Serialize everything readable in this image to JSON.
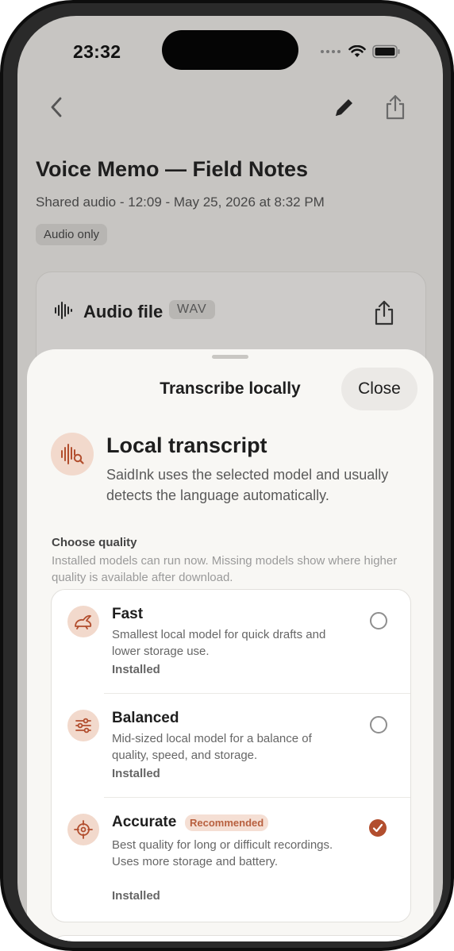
{
  "status_bar": {
    "time": "23:32",
    "icons": [
      "cellular-dots-icon",
      "wifi-icon",
      "battery-icon"
    ]
  },
  "nav": {
    "icons": [
      "chevron-left-icon",
      "pencil-icon",
      "share-icon"
    ]
  },
  "memo": {
    "title": "Voice Memo — Field Notes",
    "subtitle": "Shared audio - 12:09 - May 25, 2026 at 8:32 PM",
    "tag": "Audio only"
  },
  "audio_card": {
    "label": "Audio file",
    "format": "WAV",
    "icons": [
      "waveform-icon",
      "share-icon"
    ]
  },
  "sheet": {
    "title": "Transcribe locally",
    "close_label": "Close",
    "hero_title": "Local transcript",
    "hero_description": "SaidInk uses the selected model and usually detects the language automatically.",
    "quality_label": "Choose quality",
    "quality_hint": "Installed models can run now. Missing models show where higher quality is available after download."
  },
  "options": [
    {
      "title": "Fast",
      "description": "Smallest local model for quick drafts and lower storage use.",
      "status": "Installed",
      "icon": "rabbit-icon",
      "selected": false
    },
    {
      "title": "Balanced",
      "description": "Mid-sized local model for a balance of quality, speed, and storage.",
      "status": "Installed",
      "icon": "sliders-icon",
      "selected": false
    },
    {
      "title": "Accurate",
      "badge": "Recommended",
      "description": "Best quality for long or difficult recordings. Uses more storage and battery.",
      "status": "Installed",
      "icon": "crosshair-icon",
      "selected": true
    }
  ],
  "colors": {
    "accent": "#b24e2e",
    "accent_soft": "#f2d9cc",
    "sheet_bg": "#f8f7f4",
    "dimmed_bg": "#c7c5c2"
  }
}
